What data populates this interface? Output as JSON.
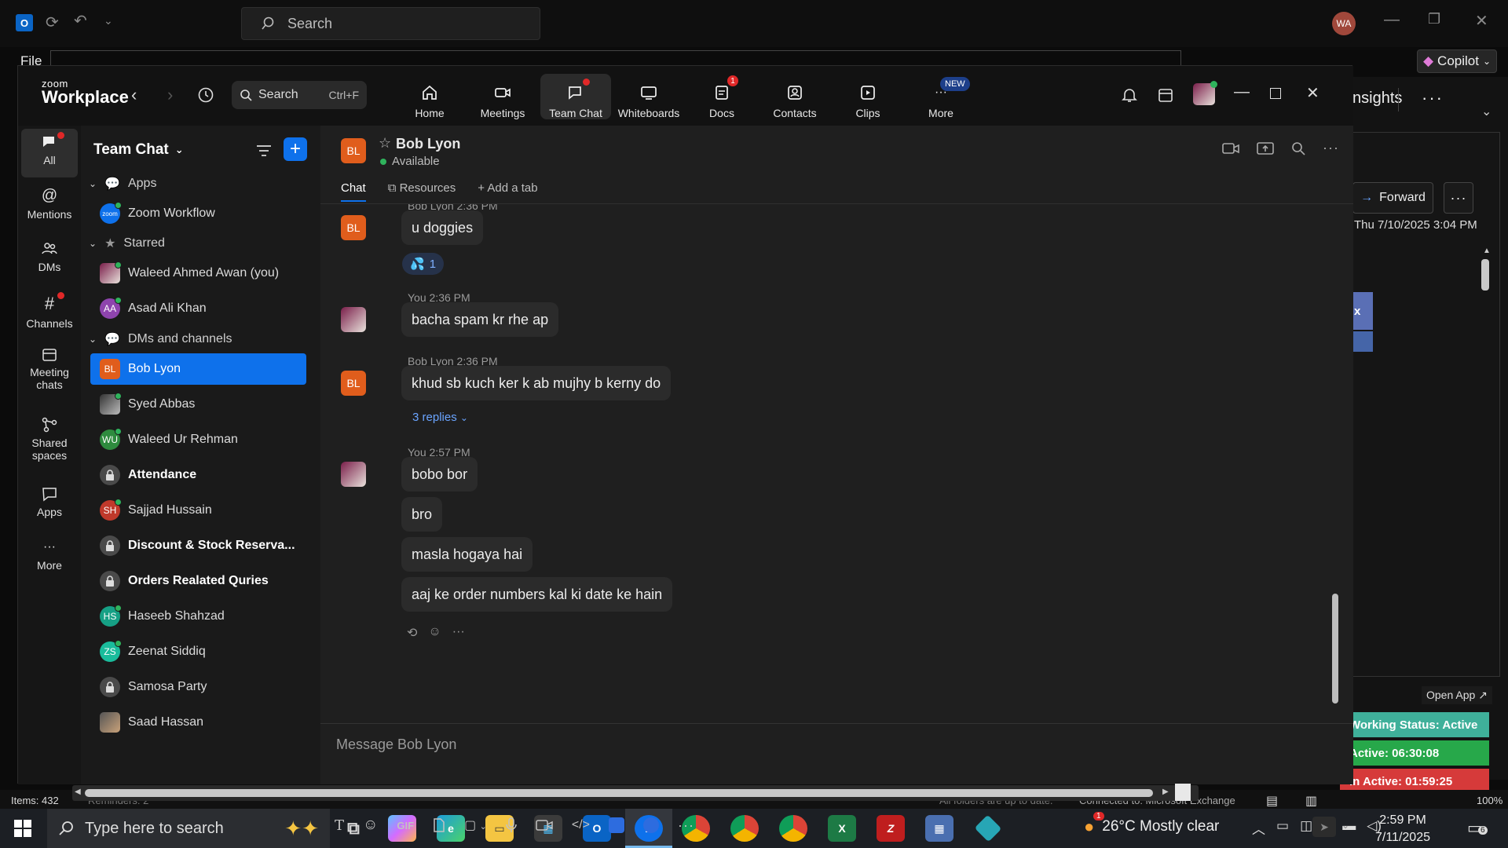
{
  "outlook": {
    "search_placeholder": "Search",
    "avatar_initials": "WA",
    "file_menu": "File",
    "copilot": "Copilot",
    "insights": "nsights",
    "forward": "Forward",
    "email_date": "Thu 7/10/2025 3:04 PM",
    "blue_char": "x",
    "open_app": "Open App ↗",
    "working_status": "Working Status: Active",
    "active_time": "Active: 06:30:08",
    "inactive_time": "In Active: 01:59:25",
    "items_count": "Items: 432",
    "status_reminders": "Reminders: 2",
    "status_folders": "All folders are up to date.",
    "status_connected": "Connected to: Microsoft Exchange",
    "zoom_pct": "100%"
  },
  "taskbar": {
    "search_placeholder": "Type here to search",
    "weather": "26°C  Mostly clear",
    "time": "2:59 PM",
    "date": "7/11/2025",
    "notif_count": "6",
    "weather_badge": "1"
  },
  "zoom": {
    "logo_top": "zoom",
    "logo_bottom": "Workplace",
    "search_label": "Search",
    "search_shortcut": "Ctrl+F",
    "nav": [
      {
        "label": "Home"
      },
      {
        "label": "Meetings"
      },
      {
        "label": "Team Chat"
      },
      {
        "label": "Whiteboards"
      },
      {
        "label": "Docs",
        "badge": "1"
      },
      {
        "label": "Contacts"
      },
      {
        "label": "Clips"
      },
      {
        "label": "More",
        "badge": "NEW"
      }
    ],
    "rail": [
      {
        "label": "All"
      },
      {
        "label": "Mentions"
      },
      {
        "label": "DMs"
      },
      {
        "label": "Channels"
      },
      {
        "label": "Meeting chats"
      },
      {
        "label": "Shared spaces"
      },
      {
        "label": "Apps"
      },
      {
        "label": "More"
      }
    ],
    "sidebar": {
      "title": "Team Chat",
      "sections": {
        "apps": "Apps",
        "starred": "Starred",
        "dms": "DMs and channels"
      },
      "apps_items": [
        {
          "name": "Zoom Workflow",
          "initials": "zoom"
        }
      ],
      "starred_items": [
        {
          "name": "Waleed Ahmed Awan (you)",
          "initials": ""
        },
        {
          "name": "Asad Ali Khan",
          "initials": "AA"
        }
      ],
      "dm_items": [
        {
          "name": "Bob Lyon",
          "initials": "BL"
        },
        {
          "name": "Syed Abbas",
          "initials": ""
        },
        {
          "name": "Waleed Ur Rehman",
          "initials": "WU"
        },
        {
          "name": "Attendance",
          "initials": ""
        },
        {
          "name": "Sajjad Hussain",
          "initials": "SH"
        },
        {
          "name": "Discount & Stock Reserva...",
          "initials": ""
        },
        {
          "name": "Orders Realated Quries",
          "initials": ""
        },
        {
          "name": "Haseeb Shahzad",
          "initials": "HS"
        },
        {
          "name": "Zeenat Siddiq",
          "initials": "ZS"
        },
        {
          "name": "Samosa Party",
          "initials": ""
        },
        {
          "name": "Saad Hassan",
          "initials": ""
        }
      ]
    },
    "chat": {
      "contact_initials": "BL",
      "contact_name": "Bob Lyon",
      "contact_status": "Available",
      "tabs": {
        "chat": "Chat",
        "resources": "Resources",
        "add": "Add a tab"
      },
      "messages": {
        "m0_meta": "Bob Lyon 2:36 PM",
        "m0_text": "u doggies",
        "m0_reaction": "1",
        "m1_meta": "You 2:36 PM",
        "m1_text": "bacha spam kr rhe ap",
        "m2_meta": "Bob Lyon 2:36 PM",
        "m2_text": "khud sb kuch ker k ab mujhy b kerny do",
        "m2_replies": "3 replies",
        "m3_meta": "You 2:57 PM",
        "m3_t1": "bobo bor",
        "m3_t2": "bro",
        "m3_t3": "masla hogaya hai",
        "m3_t4": "aaj ke order numbers kal ki date ke hain"
      },
      "composer_placeholder": "Message Bob Lyon",
      "gif_label": "GIF"
    }
  }
}
